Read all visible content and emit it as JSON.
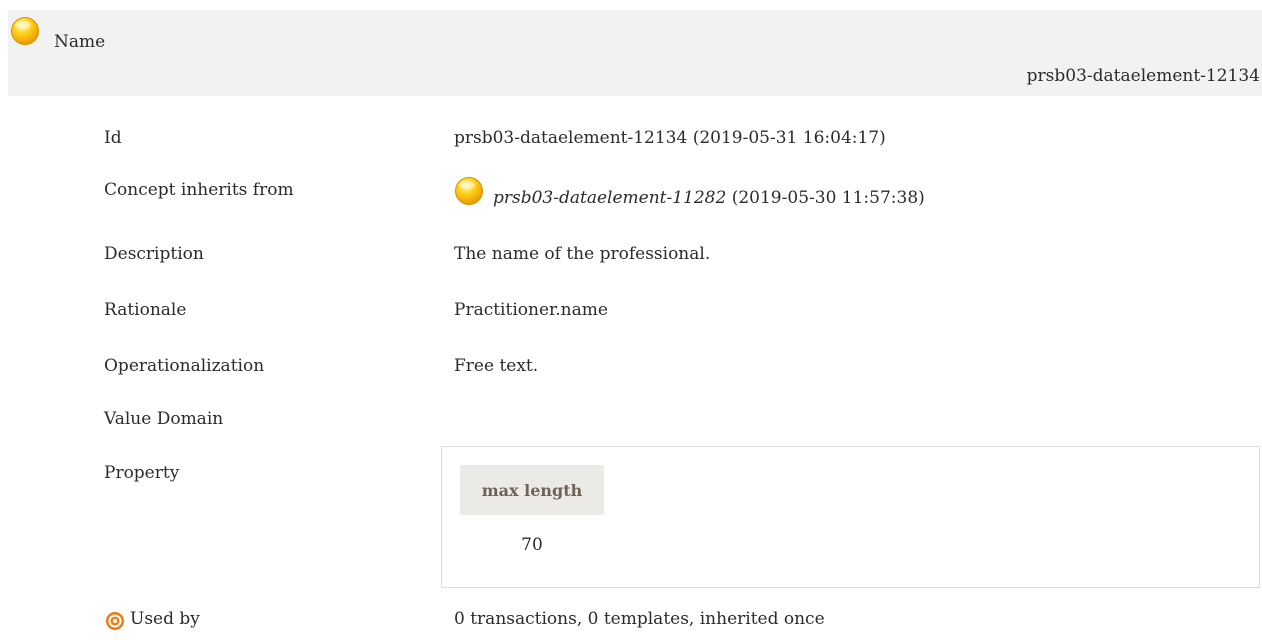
{
  "header": {
    "name": "Name",
    "id": "prsb03-dataelement-12134",
    "icon": "yellow-circle-icon"
  },
  "rows": {
    "id": {
      "label": "Id",
      "value": "prsb03-dataelement-12134 (2019-05-31 16:04:17)"
    },
    "inherits": {
      "label": "Concept inherits from",
      "link": "prsb03-dataelement-11282",
      "suffix": " (2019-05-30 11:57:38)",
      "icon": "yellow-circle-icon"
    },
    "description": {
      "label": "Description",
      "value": "The name of the professional."
    },
    "rationale": {
      "label": "Rationale",
      "value": "Practitioner.name"
    },
    "operationalization": {
      "label": "Operationalization",
      "value": "Free text."
    },
    "value_domain": {
      "label": "Value Domain"
    },
    "property": {
      "label": "Property",
      "header": "max length",
      "value": "70"
    },
    "used_by": {
      "label": "Used by",
      "value": "0 transactions, 0 templates, inherited once",
      "icon": "target-icon"
    }
  },
  "colors": {
    "header_bg": "#f2f2f2",
    "property_header_bg": "#eceae7",
    "property_header_text": "#6f6255",
    "icon_yellow": "#f5b400",
    "icon_orange": "#f07a10"
  }
}
